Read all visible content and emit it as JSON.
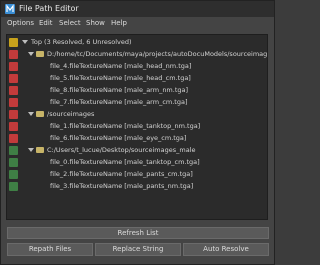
{
  "window": {
    "title": "File Path Editor"
  },
  "menu": [
    "Options",
    "Edit",
    "Select",
    "Show",
    "Help"
  ],
  "tree": {
    "top_label": "Top (3 Resolved, 6 Unresolved)",
    "groups": [
      {
        "path": "D:/home/tc/Documents/maya/projects/autoDocuModels/sourceimages",
        "items": [
          "file_4.fileTextureName [male_head_nm.tga]",
          "file_5.fileTextureName [male_head_cm.tga]",
          "file_8.fileTextureName [male_arm_nm.tga]",
          "file_7.fileTextureName [male_arm_cm.tga]"
        ]
      },
      {
        "path": "/sourceimages",
        "items": [
          "file_1.fileTextureName [male_tanktop_nm.tga]",
          "file_6.fileTextureName [male_eye_cm.tga]"
        ]
      },
      {
        "path": "C:/Users/t_lucue/Desktop/sourceimages_male",
        "items": [
          "file_0.fileTextureName [male_tanktop_cm.tga]",
          "file_2.fileTextureName [male_pants_cm.tga]",
          "file_3.fileTextureName [male_pants_nm.tga]"
        ]
      }
    ]
  },
  "buttons": {
    "refresh": "Refresh List",
    "repath": "Repath Files",
    "replace": "Replace String",
    "auto": "Auto Resolve"
  }
}
